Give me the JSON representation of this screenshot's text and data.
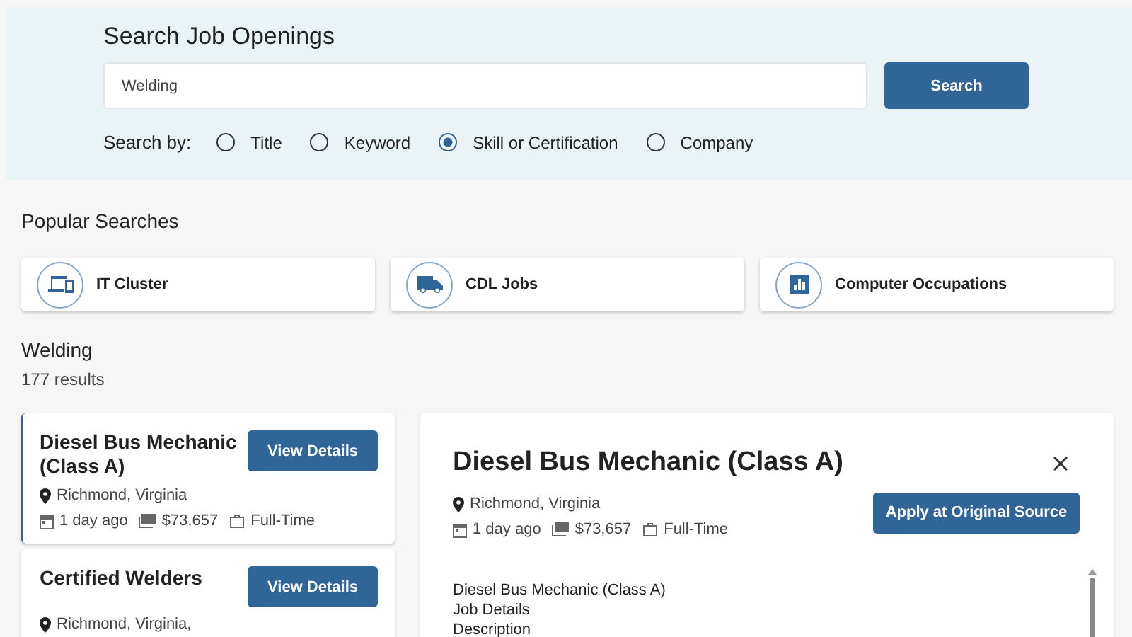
{
  "search": {
    "title": "Search Job Openings",
    "value": "Welding",
    "button": "Search",
    "search_by_label": "Search by:",
    "options": [
      {
        "label": "Title",
        "selected": false
      },
      {
        "label": "Keyword",
        "selected": false
      },
      {
        "label": "Skill or Certification",
        "selected": true
      },
      {
        "label": "Company",
        "selected": false
      }
    ]
  },
  "popular": {
    "title": "Popular Searches",
    "items": [
      {
        "label": "IT Cluster",
        "kind": "devices"
      },
      {
        "label": "CDL Jobs",
        "kind": "truck"
      },
      {
        "label": "Computer Occupations",
        "kind": "chart"
      }
    ]
  },
  "results": {
    "query": "Welding",
    "count": "177 results",
    "items": [
      {
        "title": "Diesel Bus Mechanic (Class A)",
        "location": "Richmond, Virginia",
        "posted": "1 day ago",
        "salary": "$73,657",
        "type": "Full-Time",
        "button": "View Details",
        "selected": true
      },
      {
        "title": "Certified Welders",
        "location": "Richmond, Virginia,",
        "button": "View Details",
        "selected": false
      }
    ]
  },
  "detail": {
    "title": "Diesel Bus Mechanic (Class A)",
    "location": "Richmond, Virginia",
    "posted": "1 day ago",
    "salary": "$73,657",
    "type": "Full-Time",
    "apply": "Apply at Original Source",
    "body": [
      "Diesel Bus Mechanic (Class A)",
      "Job Details",
      "Description"
    ]
  }
}
